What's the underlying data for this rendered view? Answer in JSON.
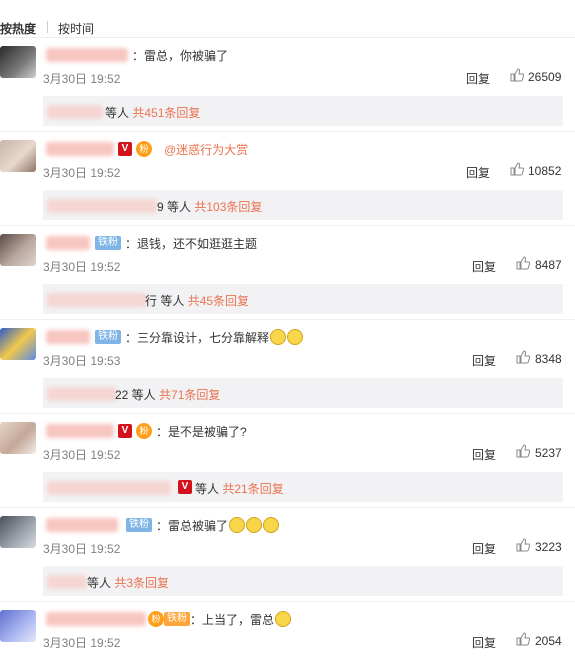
{
  "tabs": {
    "hot": "按热度",
    "time": "按时间"
  },
  "reply_label": "回复",
  "comments": [
    {
      "text": "雷总，你被骗了",
      "text_prefix": "：",
      "time": "3月30日 19:52",
      "likes": "26509",
      "reply_summary": {
        "tail": "等人",
        "count": "共451条回复"
      }
    },
    {
      "text": "@迷惑行为大赏",
      "time": "3月30日 19:52",
      "likes": "10852",
      "reply_summary": {
        "tail": "9 等人",
        "count": "共103条回复"
      }
    },
    {
      "badge": "铁粉",
      "text": "退钱，还不如逛逛主题",
      "time": "3月30日 19:52",
      "likes": "8487",
      "reply_summary": {
        "tail": "行 等人",
        "count": "共45条回复"
      }
    },
    {
      "badge": "铁粉",
      "text": "三分靠设计，七分靠解释",
      "time": "3月30日 19:53",
      "likes": "8348",
      "reply_summary": {
        "tail": "22 等人",
        "count": "共71条回复"
      }
    },
    {
      "text": "是不是被骗了?",
      "time": "3月30日 19:52",
      "likes": "5237",
      "reply_summary": {
        "tail": "等人",
        "count": "共21条回复"
      }
    },
    {
      "badge": "铁粉",
      "text": "雷总被骗了",
      "time": "3月30日 19:52",
      "likes": "3223",
      "reply_summary": {
        "tail": "等人",
        "count": "共3条回复"
      }
    },
    {
      "badge": "铁粉",
      "text": "上当了，雷总",
      "time": "3月30日 19:52",
      "likes": "2054"
    }
  ],
  "icons": {
    "verified": "V",
    "fan": "粉",
    "like": "thumbs-up-icon",
    "emoji": "emoji-icon"
  },
  "colors": {
    "accent": "#eb7350",
    "verified_red": "#d4121c",
    "badge_blue": "#7fb5e6",
    "badge_orange": "#ffa53a",
    "reply_bg": "#f2f2f5"
  }
}
